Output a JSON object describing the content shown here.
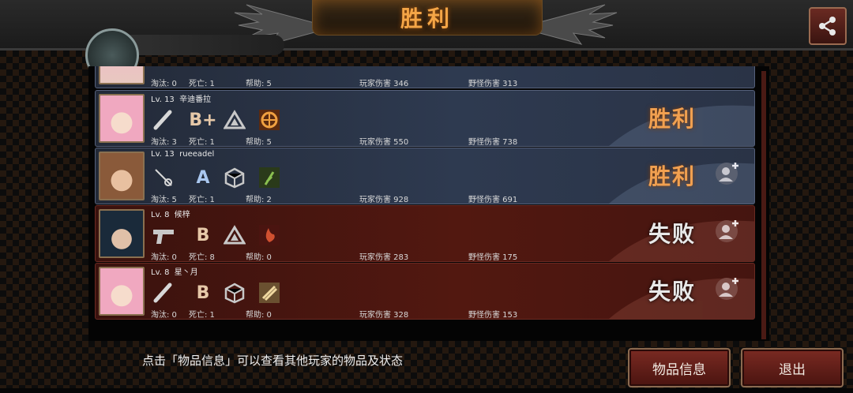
{
  "header": {
    "title": "胜利",
    "share_icon": "share-icon"
  },
  "players": [
    {
      "level": "",
      "name": "",
      "kills_label": "淘汰: 0",
      "deaths_label": "死亡: 1",
      "assists_label": "帮助: 5",
      "player_dmg_label": "玩家伤害 346",
      "monster_dmg_label": "野怪伤害 313",
      "result": "",
      "team": "win",
      "grade": "",
      "hair": "#f0b8c8"
    },
    {
      "level": "Lv. 13",
      "name": "辛迪番拉",
      "kills_label": "淘汰: 3",
      "deaths_label": "死亡: 1",
      "assists_label": "帮助: 5",
      "player_dmg_label": "玩家伤害 550",
      "monster_dmg_label": "野怪伤害 738",
      "result": "胜利",
      "team": "win",
      "grade": "B+",
      "hair": "#f0a8c0"
    },
    {
      "level": "Lv. 13",
      "name": "rueeadel",
      "kills_label": "淘汰: 5",
      "deaths_label": "死亡: 1",
      "assists_label": "帮助: 2",
      "player_dmg_label": "玩家伤害 928",
      "monster_dmg_label": "野怪伤害 691",
      "result": "胜利",
      "team": "win",
      "grade": "A",
      "hair": "#8a5a3a"
    },
    {
      "level": "Lv. 8",
      "name": "候梓",
      "kills_label": "淘汰: 0",
      "deaths_label": "死亡: 8",
      "assists_label": "帮助: 0",
      "player_dmg_label": "玩家伤害 283",
      "monster_dmg_label": "野怪伤害 175",
      "result": "失败",
      "team": "loss",
      "grade": "B",
      "hair": "#1a2a3a"
    },
    {
      "level": "Lv. 8",
      "name": "星丶月",
      "kills_label": "淘汰: 0",
      "deaths_label": "死亡: 1",
      "assists_label": "帮助: 0",
      "player_dmg_label": "玩家伤害 328",
      "monster_dmg_label": "野怪伤害 153",
      "result": "失败",
      "team": "loss",
      "grade": "B",
      "hair": "#f0a8c0"
    }
  ],
  "footer": {
    "hint": "点击「物品信息」可以查看其他玩家的物品及状态",
    "item_info_button": "物品信息",
    "exit_button": "退出"
  },
  "colors": {
    "win_text": "#f1a050",
    "win_row": "#2e3a50",
    "loss_row": "#521810",
    "accent": "#f4a546"
  }
}
